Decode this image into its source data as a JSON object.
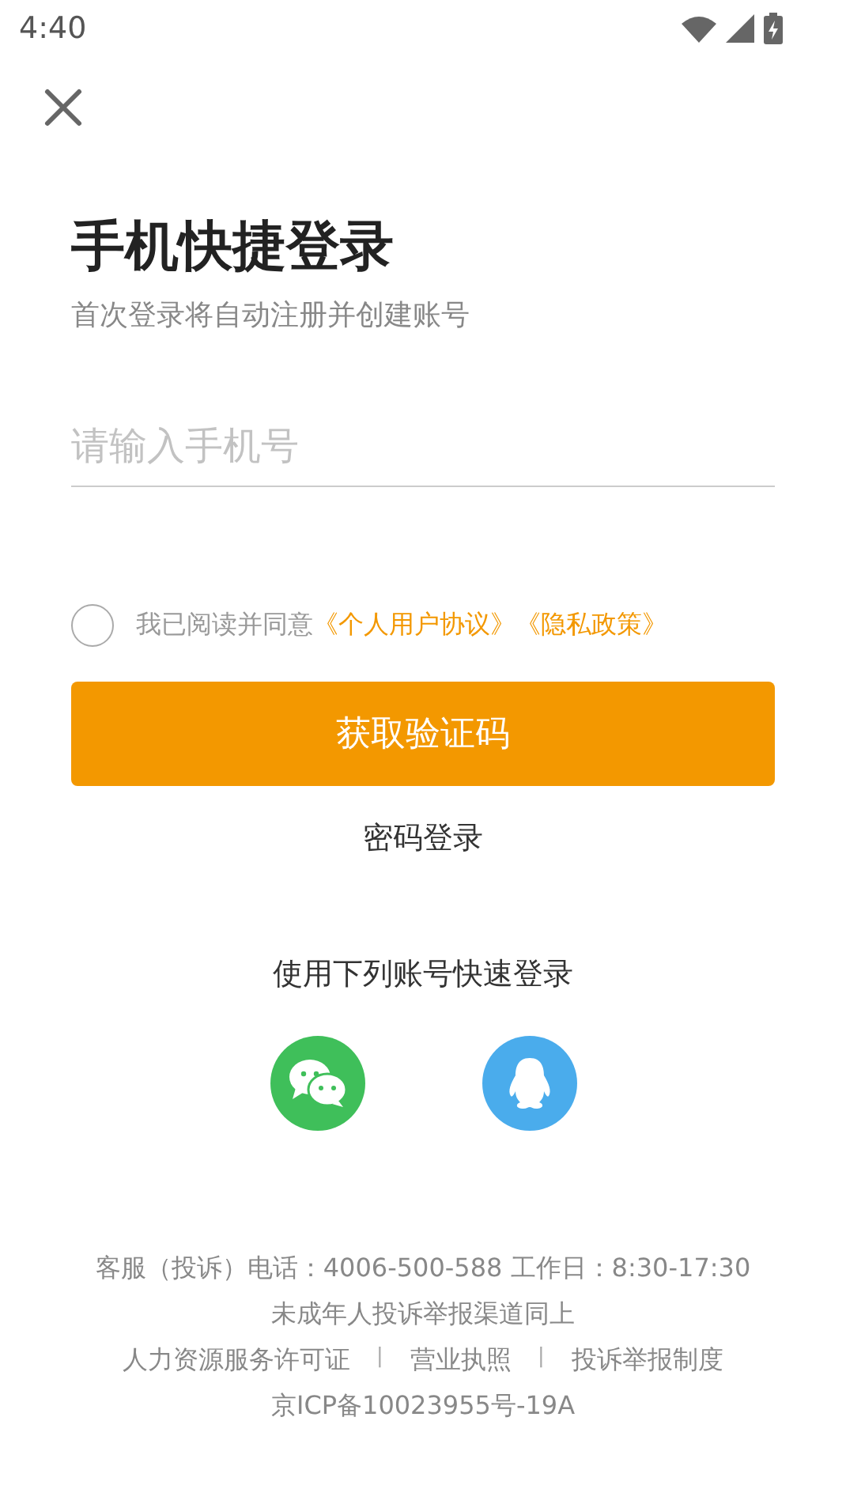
{
  "status_bar": {
    "time": "4:40"
  },
  "title": "手机快捷登录",
  "subtitle": "首次登录将自动注册并创建账号",
  "phone_field": {
    "placeholder": "请输入手机号"
  },
  "agreement": {
    "checked": false,
    "text": "我已阅读并同意",
    "links": [
      "《个人用户协议》",
      "《隐私政策》"
    ]
  },
  "primary_button": "获取验证码",
  "password_login": "密码登录",
  "social": {
    "title": "使用下列账号快速登录",
    "providers": [
      {
        "kind": "wechat"
      },
      {
        "kind": "qq"
      }
    ]
  },
  "footer": {
    "lines": [
      "客服（投诉）电话：4006-500-588 工作日：8:30-17:30",
      "未成年人投诉举报渠道同上"
    ],
    "links": [
      {
        "kind": "link",
        "text": "人力资源服务许可证"
      },
      {
        "kind": "separator",
        "text": "丨"
      },
      {
        "kind": "link",
        "text": "营业执照"
      },
      {
        "kind": "separator",
        "text": "丨"
      },
      {
        "kind": "link",
        "text": "投诉举报制度"
      }
    ],
    "icp": "京ICP备10023955号-19A"
  }
}
